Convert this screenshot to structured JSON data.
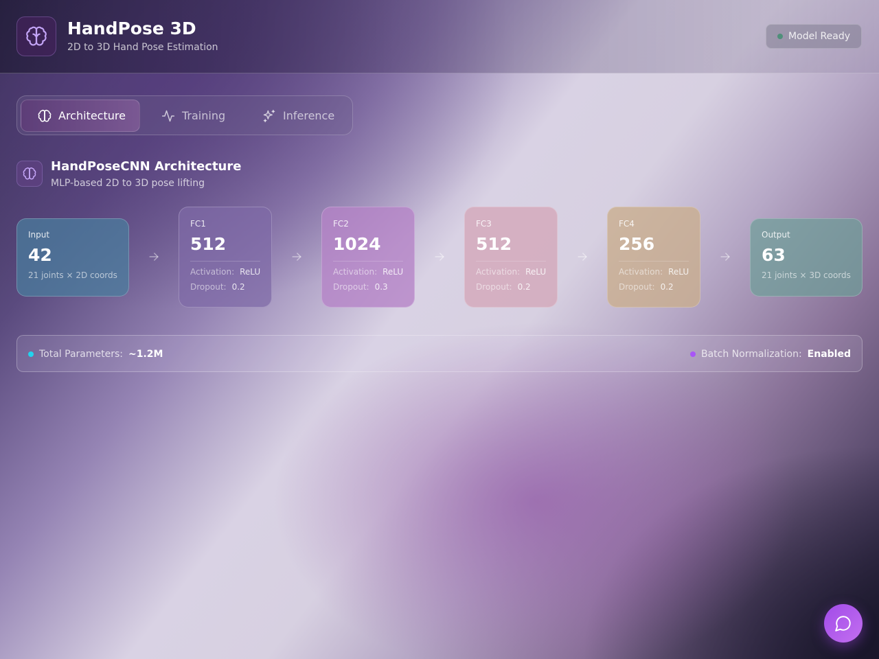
{
  "header": {
    "title": "HandPose 3D",
    "subtitle": "2D to 3D Hand Pose Estimation",
    "status": "Model Ready",
    "logo_icon": "brain-icon"
  },
  "tabs": [
    {
      "label": "Architecture",
      "icon": "brain-icon",
      "active": true
    },
    {
      "label": "Training",
      "icon": "activity-icon",
      "active": false
    },
    {
      "label": "Inference",
      "icon": "sparkles-icon",
      "active": false
    }
  ],
  "section": {
    "title": "HandPoseCNN Architecture",
    "subtitle": "MLP-based 2D to 3D pose lifting",
    "icon": "brain-icon"
  },
  "layers": [
    {
      "name": "Input",
      "units": "42",
      "desc": "21 joints × 2D coords",
      "color": "#4a7e9e"
    },
    {
      "name": "FC1",
      "units": "512",
      "activation_label": "Activation:",
      "activation": "ReLU",
      "dropout_label": "Dropout:",
      "dropout": "0.2",
      "color": "#7e6aa6"
    },
    {
      "name": "FC2",
      "units": "1024",
      "activation_label": "Activation:",
      "activation": "ReLU",
      "dropout_label": "Dropout:",
      "dropout": "0.3",
      "color": "#b583c6"
    },
    {
      "name": "FC3",
      "units": "512",
      "activation_label": "Activation:",
      "activation": "ReLU",
      "dropout_label": "Dropout:",
      "dropout": "0.2",
      "color": "#d4a6b8"
    },
    {
      "name": "FC4",
      "units": "256",
      "activation_label": "Activation:",
      "activation": "ReLU",
      "dropout_label": "Dropout:",
      "dropout": "0.2",
      "color": "#c9ae8e"
    },
    {
      "name": "Output",
      "units": "63",
      "desc": "21 joints × 3D coords",
      "color": "#6f9e98"
    }
  ],
  "summary": {
    "params_label": "Total Parameters:",
    "params_value": "~1.2M",
    "params_dot_color": "#22d3ee",
    "bn_label": "Batch Normalization:",
    "bn_value": "Enabled",
    "bn_dot_color": "#a855f7"
  },
  "chat_button": {
    "icon": "chat-bubble-icon"
  }
}
